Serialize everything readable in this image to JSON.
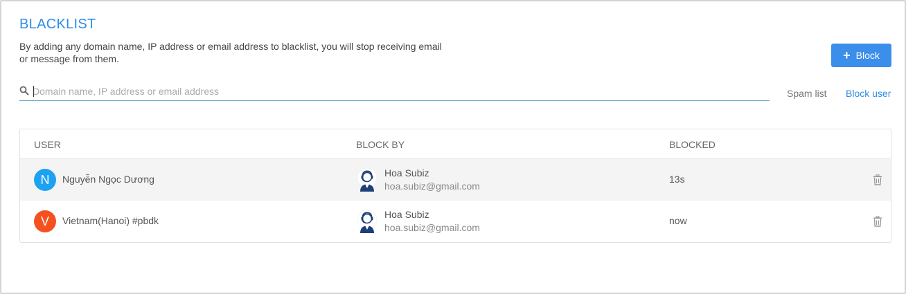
{
  "header": {
    "title": "BLACKLIST",
    "description": "By adding any domain name, IP address or email address to blacklist, you will stop receiving email or message from them.",
    "block_button_label": "Block"
  },
  "search": {
    "placeholder": "Domain name, IP address or email address",
    "value": ""
  },
  "links": {
    "spam_list": "Spam list",
    "block_user": "Block user"
  },
  "table": {
    "columns": [
      "USER",
      "BLOCK BY",
      "BLOCKED"
    ],
    "rows": [
      {
        "avatar_letter": "N",
        "avatar_color": "#1da1f2",
        "user": "Nguyễn Ngọc Dương",
        "block_by_name": "Hoa Subiz",
        "block_by_email": "hoa.subiz@gmail.com",
        "blocked": "13s"
      },
      {
        "avatar_letter": "V",
        "avatar_color": "#f4511e",
        "user": "Vietnam(Hanoi) #pbdk",
        "block_by_name": "Hoa Subiz",
        "block_by_email": "hoa.subiz@gmail.com",
        "blocked": "now"
      }
    ]
  },
  "colors": {
    "accent": "#2f8de4",
    "button": "#3b8eea"
  },
  "icons": {
    "search": "search-icon",
    "plus": "plus-icon",
    "agent": "agent-headset-icon",
    "delete": "trash-icon"
  }
}
